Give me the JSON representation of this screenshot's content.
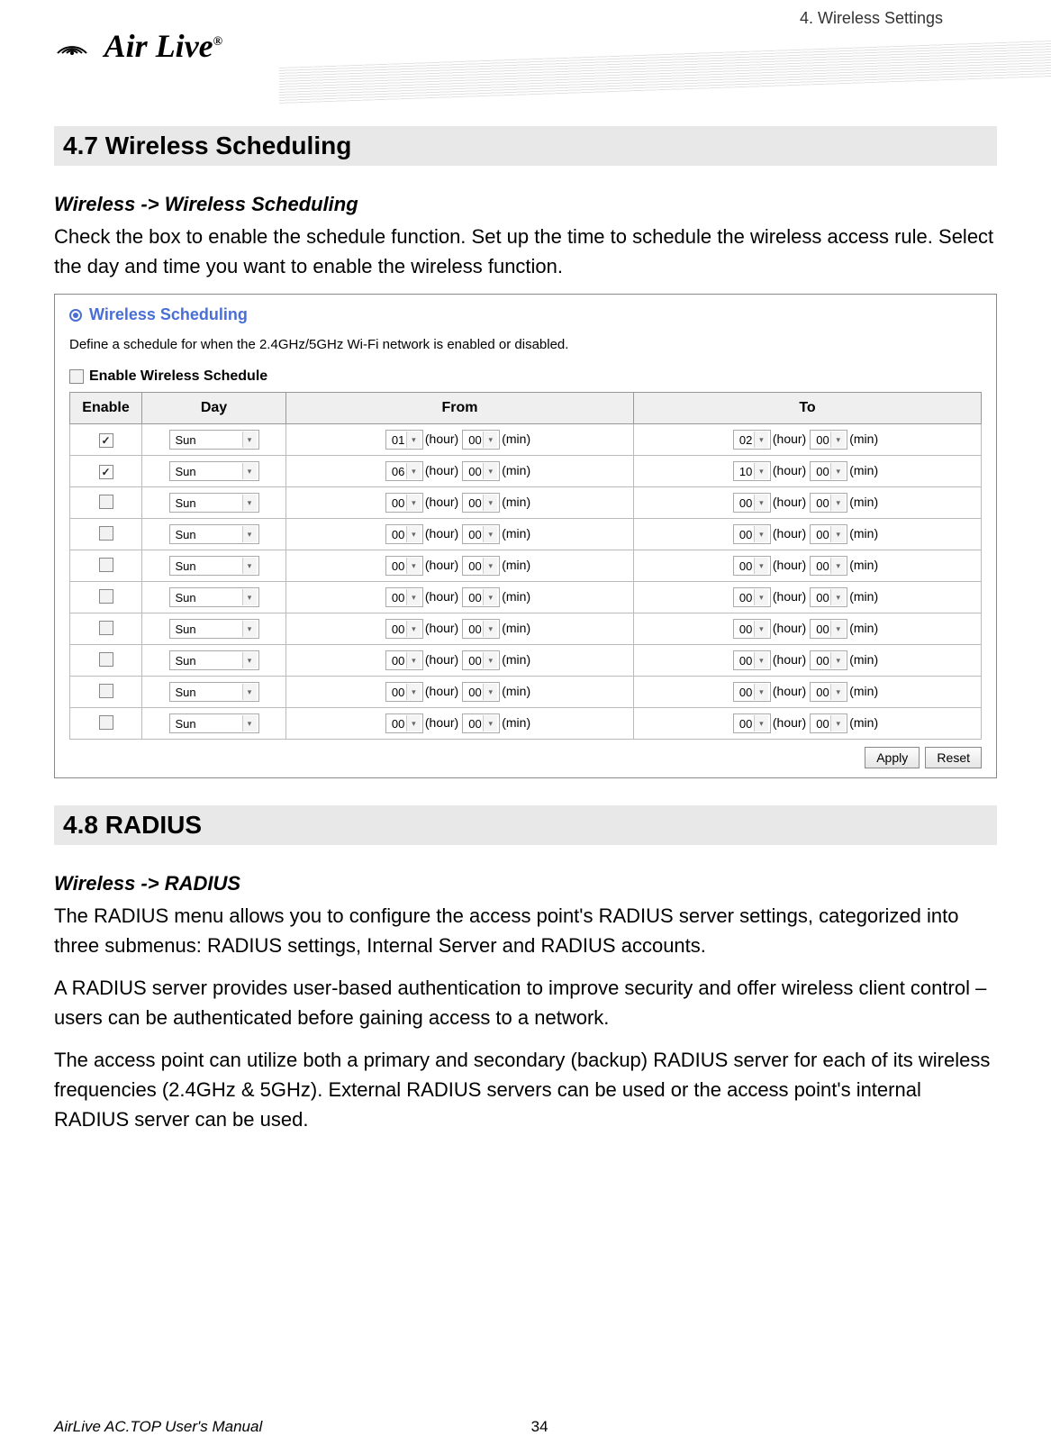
{
  "chapter": "4. Wireless Settings",
  "logo_text": "Air Live",
  "section47": {
    "heading": "4.7 Wireless Scheduling",
    "nav": "Wireless -> Wireless Scheduling",
    "body": "Check the box to enable the schedule function. Set up the time to schedule the wireless access rule. Select the day and time you want to enable the wireless function."
  },
  "screenshot": {
    "title": "Wireless Scheduling",
    "desc": "Define a schedule for when the 2.4GHz/5GHz Wi-Fi network is enabled or disabled.",
    "enable_label": "Enable Wireless Schedule",
    "columns": {
      "c1": "Enable",
      "c2": "Day",
      "c3": "From",
      "c4": "To"
    },
    "hour_label": "(hour)",
    "min_label": "(min)",
    "rows": [
      {
        "checked": true,
        "day": "Sun",
        "from_h": "01",
        "from_m": "00",
        "to_h": "02",
        "to_m": "00"
      },
      {
        "checked": true,
        "day": "Sun",
        "from_h": "06",
        "from_m": "00",
        "to_h": "10",
        "to_m": "00"
      },
      {
        "checked": false,
        "day": "Sun",
        "from_h": "00",
        "from_m": "00",
        "to_h": "00",
        "to_m": "00"
      },
      {
        "checked": false,
        "day": "Sun",
        "from_h": "00",
        "from_m": "00",
        "to_h": "00",
        "to_m": "00"
      },
      {
        "checked": false,
        "day": "Sun",
        "from_h": "00",
        "from_m": "00",
        "to_h": "00",
        "to_m": "00"
      },
      {
        "checked": false,
        "day": "Sun",
        "from_h": "00",
        "from_m": "00",
        "to_h": "00",
        "to_m": "00"
      },
      {
        "checked": false,
        "day": "Sun",
        "from_h": "00",
        "from_m": "00",
        "to_h": "00",
        "to_m": "00"
      },
      {
        "checked": false,
        "day": "Sun",
        "from_h": "00",
        "from_m": "00",
        "to_h": "00",
        "to_m": "00"
      },
      {
        "checked": false,
        "day": "Sun",
        "from_h": "00",
        "from_m": "00",
        "to_h": "00",
        "to_m": "00"
      },
      {
        "checked": false,
        "day": "Sun",
        "from_h": "00",
        "from_m": "00",
        "to_h": "00",
        "to_m": "00"
      }
    ],
    "apply": "Apply",
    "reset": "Reset"
  },
  "section48": {
    "heading": "4.8 RADIUS",
    "nav": "Wireless -> RADIUS",
    "p1": "The RADIUS menu allows you to configure the access point's RADIUS server settings, categorized into three submenus: RADIUS settings, Internal Server and RADIUS accounts.",
    "p2": "A RADIUS server provides user-based authentication to improve security and offer wireless client control – users can be authenticated before gaining access to a network.",
    "p3": "The access point can utilize both a primary and secondary (backup) RADIUS server for each of its wireless frequencies (2.4GHz & 5GHz). External RADIUS servers can be used or the access point's internal RADIUS server can be used."
  },
  "footer": {
    "left": "AirLive AC.TOP User's Manual",
    "page": "34"
  }
}
